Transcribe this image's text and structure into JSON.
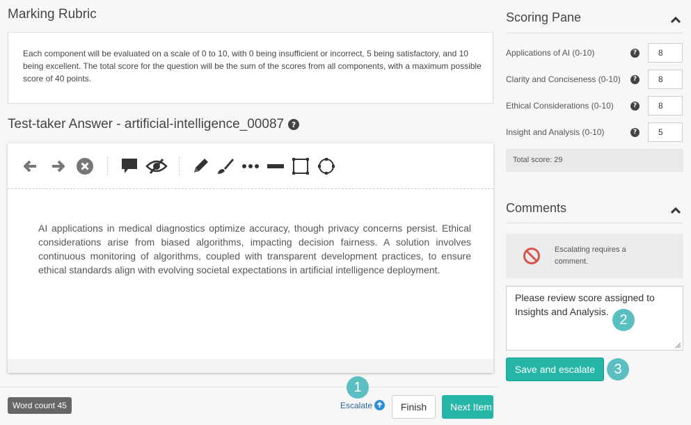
{
  "rubric": {
    "title": "Marking Rubric",
    "text": "Each component will be evaluated on a scale of 0 to 10, with 0 being insufficient or incorrect, 5 being satisfactory, and 10 being excellent. The total score for the question will be the sum of the scores from all components, with a maximum possible score of 40 points."
  },
  "answer": {
    "title": "Test-taker Answer - artificial-intelligence_00087",
    "text": "AI applications in medical diagnostics optimize accuracy, though privacy concerns persist. Ethical considerations arise from biased algorithms, impacting decision fairness. A solution involves continuous monitoring of algorithms, coupled with transparent development practices, to ensure ethical standards align with evolving societal expectations in artificial intelligence deployment.",
    "toolbar_icons": [
      "arrow-left-icon",
      "arrow-right-icon",
      "clear-circle-icon",
      "comment-icon",
      "hide-eye-icon",
      "pencil-icon",
      "brush-icon",
      "dotted-line-icon",
      "solid-line-icon",
      "rectangle-icon",
      "circle-icon"
    ]
  },
  "footer": {
    "word_count": "Word count 45",
    "escalate_label": "Escalate",
    "finish_label": "Finish",
    "next_label": "Next Item"
  },
  "scoring": {
    "title": "Scoring Pane",
    "rows": [
      {
        "label": "Applications of AI (0-10)",
        "value": "8"
      },
      {
        "label": "Clarity and Conciseness (0-10)",
        "value": "8"
      },
      {
        "label": "Ethical Considerations (0-10)",
        "value": "8"
      },
      {
        "label": "Insight and Analysis (0-10)",
        "value": "5"
      }
    ],
    "total": "Total score: 29"
  },
  "comments": {
    "title": "Comments",
    "warning": "Escalating requires a comment.",
    "comment_text": "Please review score assigned to Insights and Analysis.",
    "save_label": "Save and escalate"
  },
  "callouts": [
    "1",
    "2",
    "3"
  ],
  "colors": {
    "accent": "#25b6a7",
    "callout": "#5bbec1",
    "warning": "#d9534f",
    "link": "#2a6496"
  }
}
